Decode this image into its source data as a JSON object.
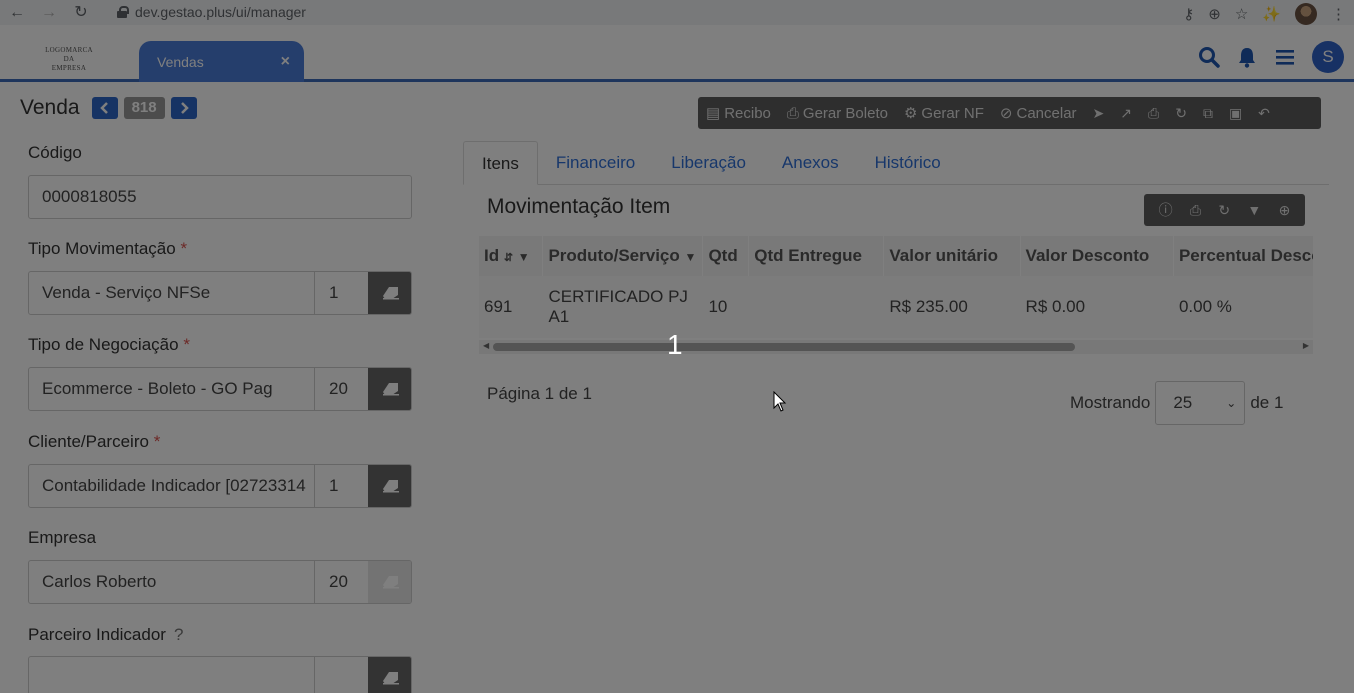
{
  "browser": {
    "url": "dev.gestao.plus/ui/manager"
  },
  "header": {
    "logo_line1": "LOGOMARCA",
    "logo_line2": "DA",
    "logo_line3": "EMPRESA",
    "tab_label": "Vendas",
    "tab_close": "×",
    "avatar_letter": "S"
  },
  "page": {
    "title": "Venda",
    "record_number": "818"
  },
  "toolbar": {
    "recibo": "Recibo",
    "gerar_boleto": "Gerar Boleto",
    "gerar_nf": "Gerar NF",
    "cancelar": "Cancelar"
  },
  "form": {
    "codigo_label": "Código",
    "codigo_value": "0000818055",
    "tipo_mov_label": "Tipo Movimentação",
    "tipo_mov_value": "Venda - Serviço NFSe",
    "tipo_mov_code": "1",
    "tipo_neg_label": "Tipo de Negociação",
    "tipo_neg_value": "Ecommerce - Boleto - GO Pag",
    "tipo_neg_code": "20",
    "cliente_label": "Cliente/Parceiro",
    "cliente_value": "Contabilidade Indicador [02723314",
    "cliente_code": "1",
    "empresa_label": "Empresa",
    "empresa_value": "Carlos Roberto",
    "empresa_code": "20",
    "parceiro_label": "Parceiro Indicador",
    "parceiro_help": "?",
    "parceiro_value": "",
    "parceiro_code": "",
    "required_mark": "*"
  },
  "tabs": [
    "Itens",
    "Financeiro",
    "Liberação",
    "Anexos",
    "Histórico"
  ],
  "grid": {
    "title": "Movimentação Item",
    "columns": [
      "Id",
      "Produto/Serviço",
      "Qtd",
      "Qtd Entregue",
      "Valor unitário",
      "Valor Desconto",
      "Percentual Desconto"
    ],
    "rows": [
      [
        "691",
        "CERTIFICADO PJ A1",
        "10",
        "",
        "R$ 235.00",
        "R$ 0.00",
        "0.00 %"
      ]
    ],
    "pager_text": "Página 1 de 1",
    "showing_label": "Mostrando",
    "page_size": "25",
    "of_total": "de 1"
  },
  "overlay": {
    "number": "1"
  }
}
